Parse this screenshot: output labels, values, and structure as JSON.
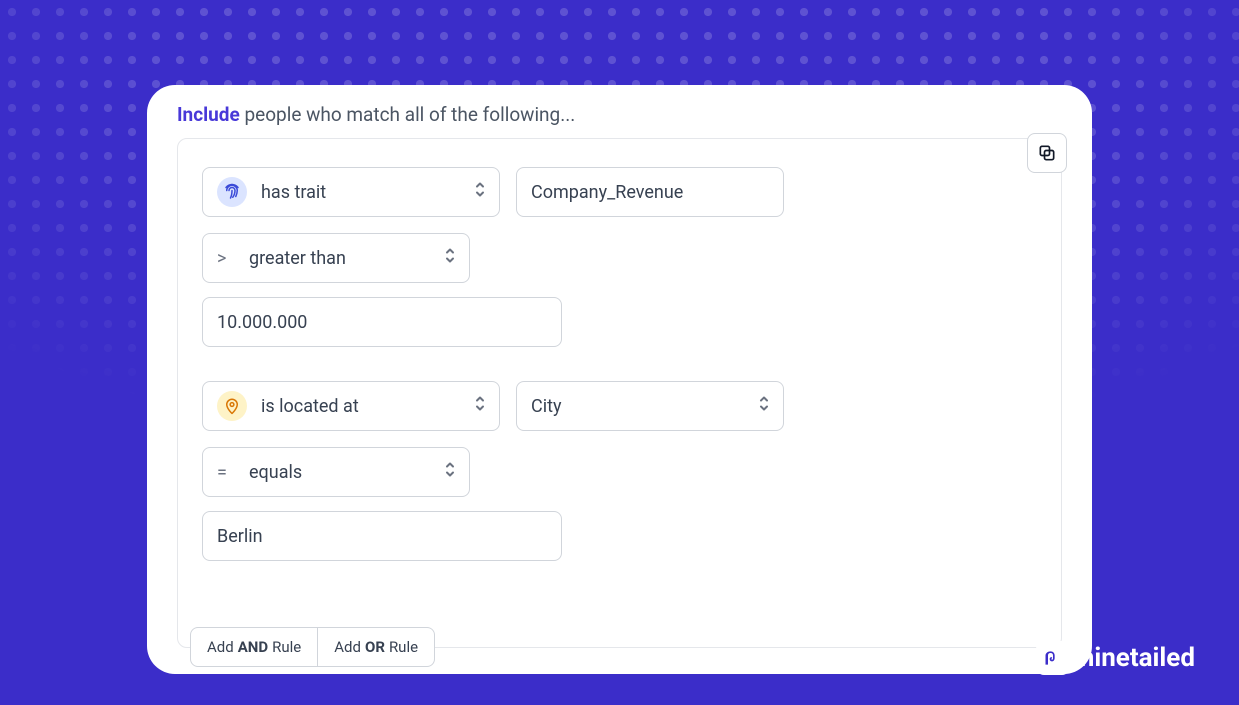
{
  "header": {
    "include_label": "Include",
    "rest_label": " people who match all of the following..."
  },
  "rules": [
    {
      "type_label": "has trait",
      "type_icon": "fingerprint",
      "attribute": "Company_Revenue",
      "op_symbol": ">",
      "op_label": "greater than",
      "value": "10.000.000"
    },
    {
      "type_label": "is located at",
      "type_icon": "location",
      "attribute": "City",
      "op_symbol": "=",
      "op_label": "equals",
      "value": "Berlin"
    }
  ],
  "footer": {
    "and_prefix": "Add ",
    "and_bold": "AND",
    "and_suffix": " Rule",
    "or_prefix": "Add ",
    "or_bold": "OR",
    "or_suffix": " Rule"
  },
  "brand": {
    "name": "ninetailed"
  }
}
